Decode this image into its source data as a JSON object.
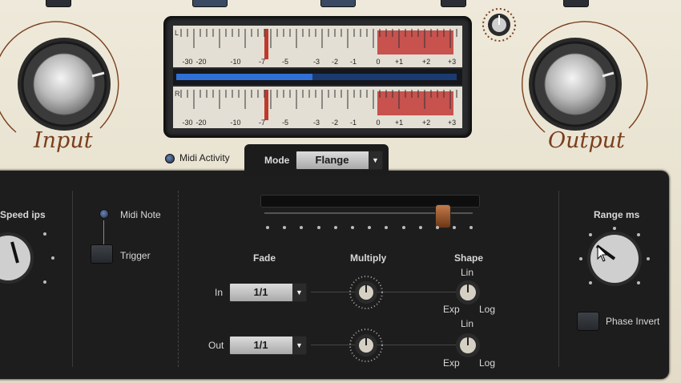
{
  "meter": {
    "channel_top": "L",
    "channel_bottom": "R",
    "scale": [
      "-30",
      "-20",
      "-10",
      "-7",
      "-5",
      "-3",
      "-2",
      "-1",
      "0",
      "+1",
      "+2",
      "+3"
    ]
  },
  "knobs": {
    "input_label": "Input",
    "output_label": "Output"
  },
  "midi_activity": "Midi Activity",
  "mode": {
    "label": "Mode",
    "value": "Flange"
  },
  "controls": {
    "speed_label": "Speed ips",
    "midi_note": "Midi Note",
    "trigger": "Trigger",
    "fade": "Fade",
    "multiply": "Multiply",
    "shape": "Shape",
    "in_label": "In",
    "out_label": "Out",
    "in_value": "1/1",
    "out_value": "1/1",
    "lin": "Lin",
    "exp": "Exp",
    "log": "Log",
    "range_label": "Range ms",
    "phase_invert": "Phase Invert"
  },
  "colors": {
    "accent": "#7a3f1c",
    "panel": "#1d1d1d",
    "meter_red": "#c0392b",
    "meter_blue": "#2f6fd6"
  }
}
